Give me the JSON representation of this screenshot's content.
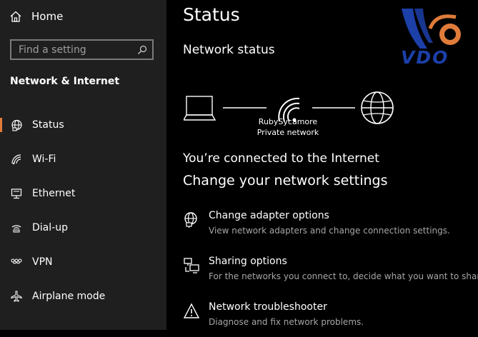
{
  "sidebar": {
    "home_label": "Home",
    "search_placeholder": "Find a setting",
    "section_title": "Network & Internet",
    "items": [
      {
        "label": "Status",
        "icon": "globe-status-icon",
        "active": true
      },
      {
        "label": "Wi-Fi",
        "icon": "wifi-icon"
      },
      {
        "label": "Ethernet",
        "icon": "ethernet-icon"
      },
      {
        "label": "Dial-up",
        "icon": "dialup-icon"
      },
      {
        "label": "VPN",
        "icon": "vpn-icon"
      },
      {
        "label": "Airplane mode",
        "icon": "airplane-icon"
      }
    ],
    "accent_color": "#e07b3a"
  },
  "main": {
    "title": "Status",
    "network_status_heading": "Network status",
    "network_name": "RubySycamore",
    "network_type": "Private network",
    "connected_text": "You’re connected to the Internet",
    "change_heading": "Change your network settings",
    "options": [
      {
        "title": "Change adapter options",
        "desc": "View network adapters and change connection settings.",
        "icon": "adapter-icon"
      },
      {
        "title": "Sharing options",
        "desc": "For the networks you connect to, decide what you want to share.",
        "icon": "sharing-icon"
      },
      {
        "title": "Network troubleshooter",
        "desc": "Diagnose and fix network problems.",
        "icon": "warning-icon"
      }
    ]
  },
  "watermark": {
    "text": "VDO"
  }
}
